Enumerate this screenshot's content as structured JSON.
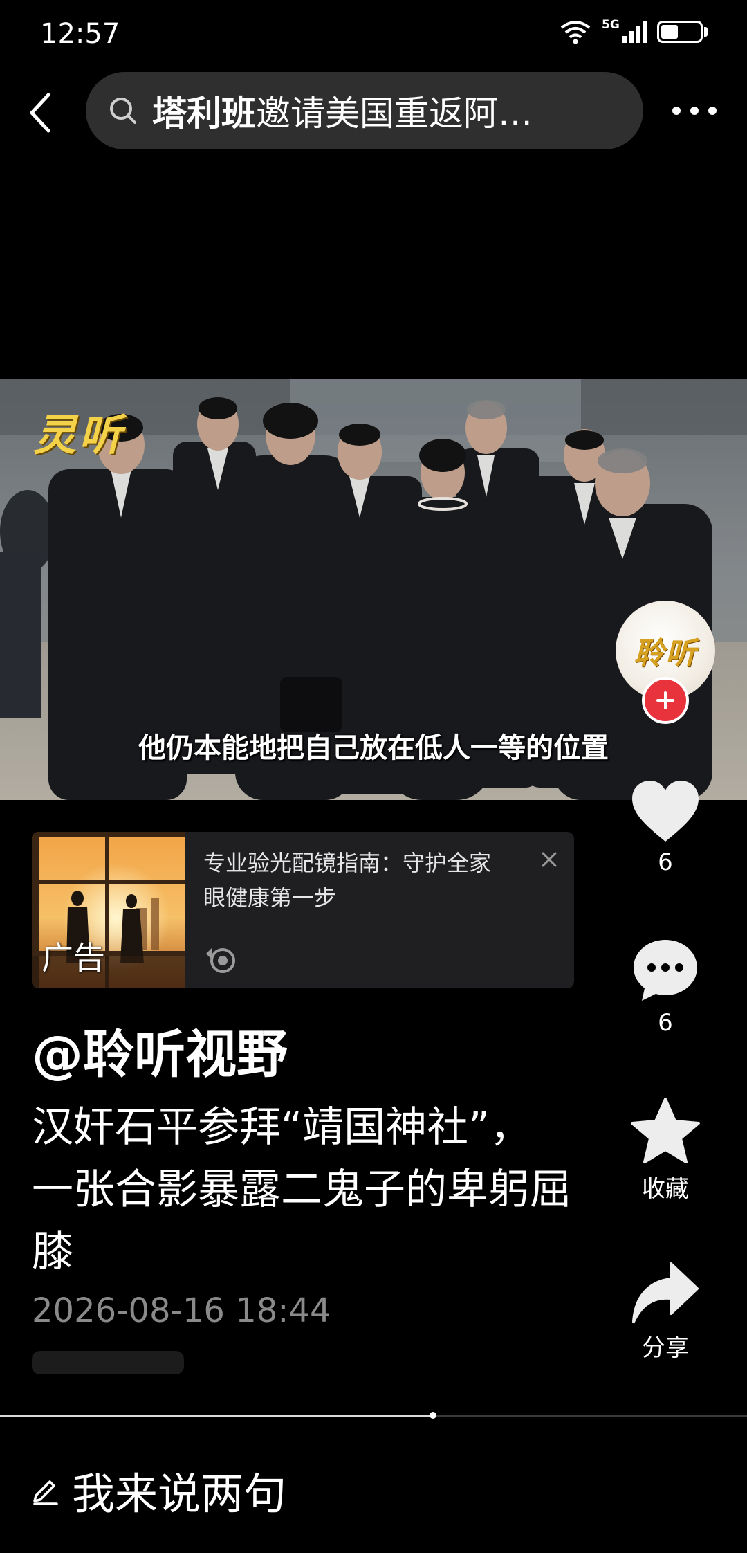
{
  "status_bar": {
    "time": "12:57",
    "network": "5G",
    "battery_percent": 45
  },
  "search": {
    "query_bold": "塔利班",
    "query_rest": "邀请美国重返阿…"
  },
  "video": {
    "watermark": "灵听",
    "subtitle": "他仍本能地把自己放在低人一等的位置",
    "progress": 0.58
  },
  "actions": {
    "avatar_text": "聆听",
    "like_count": "6",
    "comment_count": "6",
    "favorite_label": "收藏",
    "share_label": "分享"
  },
  "ad": {
    "title": "专业验光配镜指南：守护全家眼健康第一步",
    "tag": "广告"
  },
  "post": {
    "author": "@聆听视野",
    "title": "汉奸石平参拜“靖国神社”，一张合影暴露二鬼子的卑躬屈膝",
    "date": "2026-08-16 18:44"
  },
  "comment": {
    "placeholder": "我来说两句"
  },
  "colors": {
    "background": "#000000",
    "follow_red": "#e8323c",
    "ad_bg": "#1f1f21"
  }
}
